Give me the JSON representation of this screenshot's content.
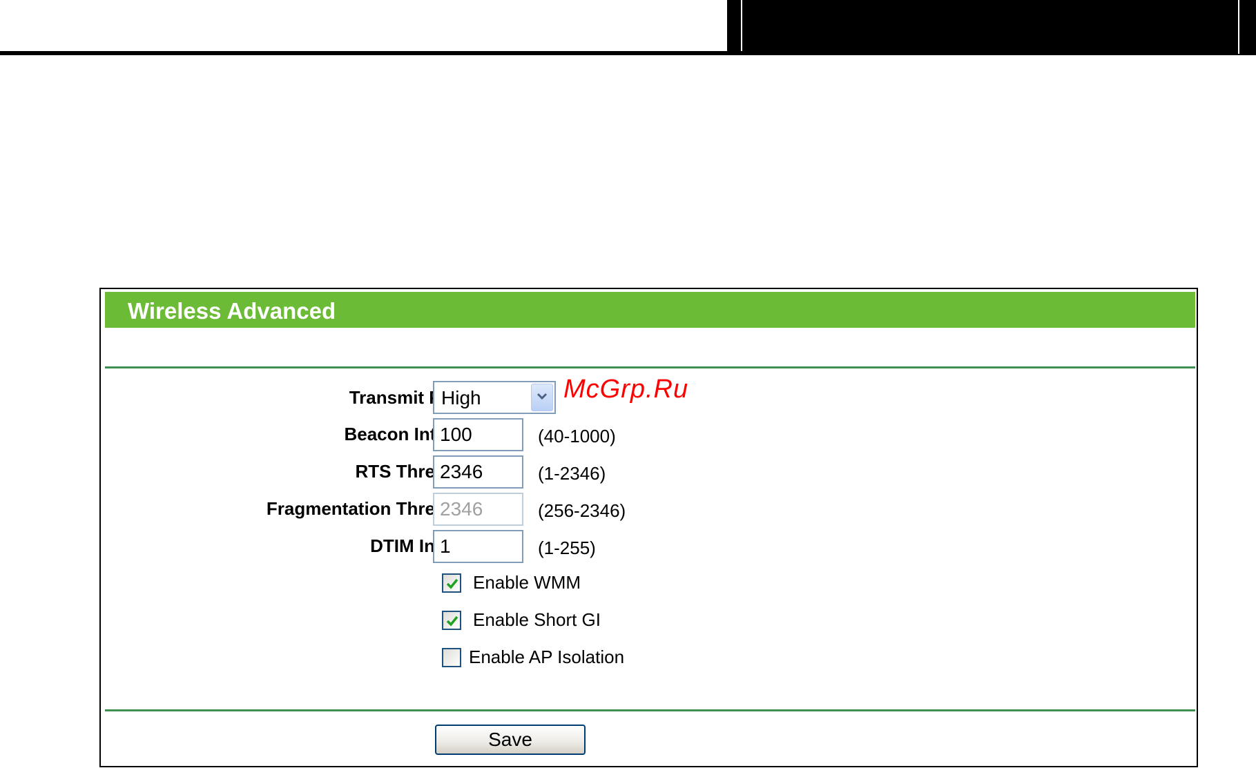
{
  "panel": {
    "title": "Wireless Advanced"
  },
  "watermark": "McGrp.Ru",
  "transmit_power": {
    "label": "Transmit Power:",
    "selected": "High"
  },
  "beacon_interval": {
    "label": "Beacon Interval :",
    "value": "100",
    "hint": "(40-1000)"
  },
  "rts_threshold": {
    "label": "RTS Threshold:",
    "value": "2346",
    "hint": "(1-2346)"
  },
  "fragmentation_threshold": {
    "label": "Fragmentation Threshold:",
    "value": "2346",
    "hint": "(256-2346)",
    "disabled": true
  },
  "dtim_interval": {
    "label": "DTIM Interval:",
    "value": "1",
    "hint": "(1-255)"
  },
  "checkboxes": [
    {
      "label": "Enable WMM",
      "checked": true
    },
    {
      "label": "Enable Short GI",
      "checked": true
    },
    {
      "label": "Enable AP Isolation",
      "checked": false
    }
  ],
  "save_button": {
    "label": "Save"
  },
  "colors": {
    "title_bar": "#6bbb36",
    "rule": "#3f8f52",
    "watermark": "#ff0000",
    "checkmark": "#21a121"
  }
}
